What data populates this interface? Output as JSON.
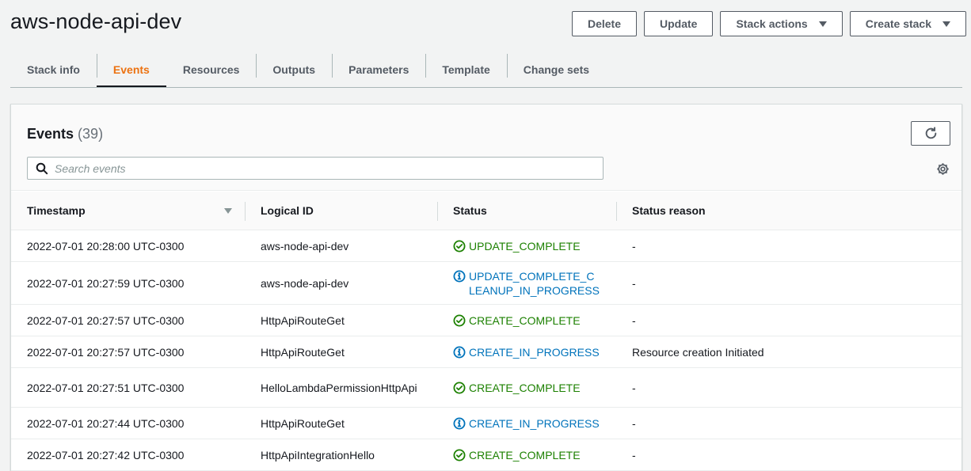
{
  "stack": {
    "name": "aws-node-api-dev"
  },
  "actions": {
    "delete": "Delete",
    "update": "Update",
    "stack_actions": "Stack actions",
    "create_stack": "Create stack"
  },
  "tabs": [
    {
      "label": "Stack info"
    },
    {
      "label": "Events"
    },
    {
      "label": "Resources"
    },
    {
      "label": "Outputs"
    },
    {
      "label": "Parameters"
    },
    {
      "label": "Template"
    },
    {
      "label": "Change sets"
    }
  ],
  "events": {
    "title": "Events",
    "count": "(39)",
    "search_placeholder": "Search events",
    "columns": {
      "timestamp": "Timestamp",
      "logical_id": "Logical ID",
      "status": "Status",
      "status_reason": "Status reason"
    },
    "rows": [
      {
        "timestamp": "2022-07-01 20:28:00 UTC-0300",
        "logical_id": "aws-node-api-dev",
        "status": "UPDATE_COMPLETE",
        "status_type": "ok",
        "reason": "-"
      },
      {
        "timestamp": "2022-07-01 20:27:59 UTC-0300",
        "logical_id": "aws-node-api-dev",
        "status": "UPDATE_COMPLETE_CLEANUP_IN_PROGRESS",
        "status_type": "info",
        "reason": "-"
      },
      {
        "timestamp": "2022-07-01 20:27:57 UTC-0300",
        "logical_id": "HttpApiRouteGet",
        "status": "CREATE_COMPLETE",
        "status_type": "ok",
        "reason": "-"
      },
      {
        "timestamp": "2022-07-01 20:27:57 UTC-0300",
        "logical_id": "HttpApiRouteGet",
        "status": "CREATE_IN_PROGRESS",
        "status_type": "info",
        "reason": "Resource creation Initiated"
      },
      {
        "timestamp": "2022-07-01 20:27:51 UTC-0300",
        "logical_id": "HelloLambdaPermissionHttpApi",
        "status": "CREATE_COMPLETE",
        "status_type": "ok",
        "reason": "-"
      },
      {
        "timestamp": "2022-07-01 20:27:44 UTC-0300",
        "logical_id": "HttpApiRouteGet",
        "status": "CREATE_IN_PROGRESS",
        "status_type": "info",
        "reason": "-"
      },
      {
        "timestamp": "2022-07-01 20:27:42 UTC-0300",
        "logical_id": "HttpApiIntegrationHello",
        "status": "CREATE_COMPLETE",
        "status_type": "ok",
        "reason": "-"
      }
    ]
  },
  "icons": {
    "ok": "status-success-icon",
    "info": "status-info-icon",
    "refresh": "refresh-icon",
    "settings": "gear-icon",
    "search": "search-icon"
  },
  "colors": {
    "active_tab": "#ec7211",
    "success": "#1d8102",
    "info": "#0073bb"
  }
}
